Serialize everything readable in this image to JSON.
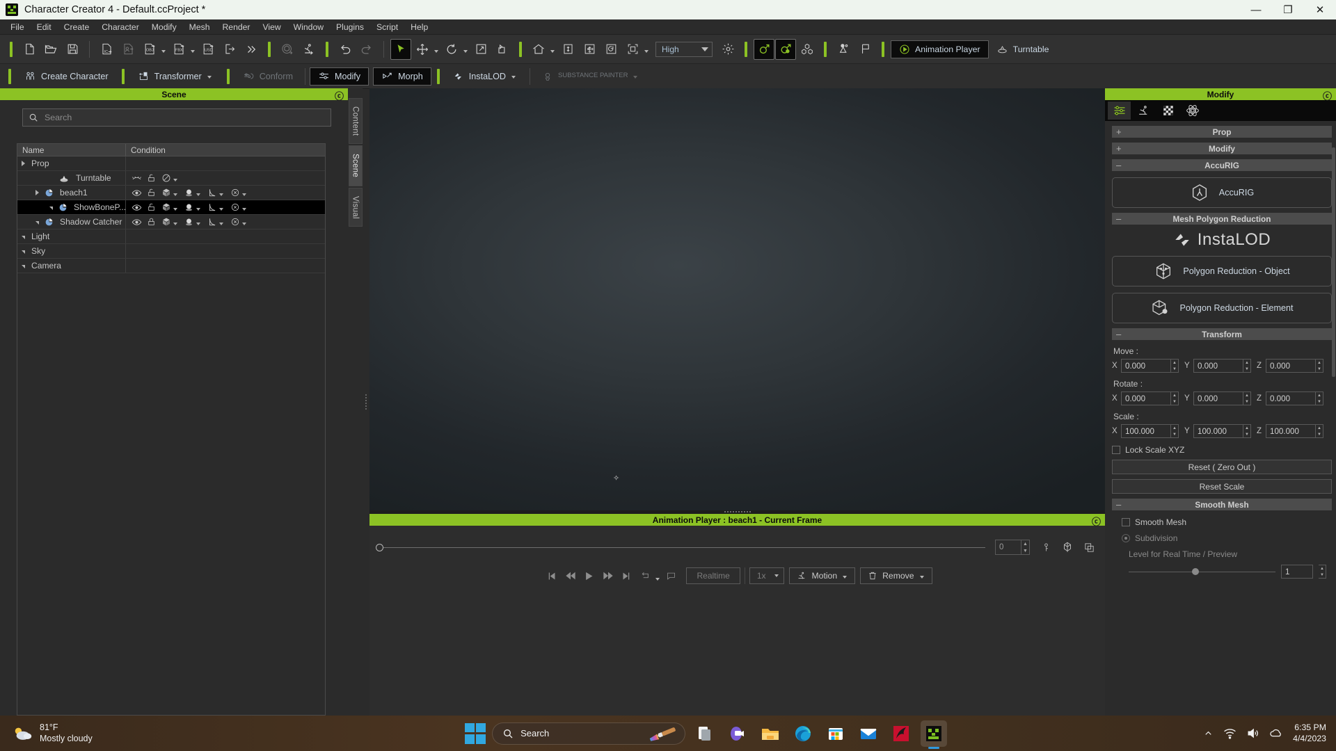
{
  "window": {
    "title": "Character Creator 4 - Default.ccProject *",
    "app_icon": "character-creator-icon",
    "minimize": "—",
    "maximize": "❐",
    "close": "✕"
  },
  "menubar": {
    "items": [
      "File",
      "Edit",
      "Create",
      "Character",
      "Modify",
      "Mesh",
      "Render",
      "View",
      "Window",
      "Plugins",
      "Script",
      "Help"
    ]
  },
  "toolbar_main": {
    "quality_combo": {
      "value": "High"
    },
    "animation_player_label": "Animation Player",
    "turntable_label": "Turntable",
    "icons": [
      "new-file-icon",
      "open-folder-icon",
      "save-icon",
      "import-iclone-icon",
      "import-character-icon",
      "export-obj-icon",
      "export-fbx-icon",
      "export-usd-icon",
      "export-icon",
      "more-chevrons-icon",
      "render-cube-icon",
      "export-motion-icon",
      "undo-icon",
      "redo-icon",
      "select-arrow-icon",
      "move-icon",
      "rotate-icon",
      "scale-icon",
      "pivot-icon",
      "home-view-icon",
      "fit-vertical-icon",
      "fit-all-icon",
      "orbit-icon",
      "frame-selected-icon",
      "light-icon",
      "male-character-icon",
      "female-character-icon",
      "props-icon",
      "stage-icon",
      "flag-icon",
      "play-circle-icon",
      "turntable-icon"
    ]
  },
  "toolbar_modes": {
    "buttons": [
      {
        "label": "Create Character",
        "icon": "create-character-icon",
        "state": "normal",
        "dropdown": false
      },
      {
        "label": "Transformer",
        "icon": "transformer-icon",
        "state": "normal",
        "dropdown": true
      },
      {
        "label": "Conform",
        "icon": "conform-icon",
        "state": "disabled",
        "dropdown": false
      },
      {
        "label": "Modify",
        "icon": "modify-sliders-icon",
        "state": "active",
        "dropdown": false
      },
      {
        "label": "Morph",
        "icon": "morph-icon",
        "state": "active",
        "dropdown": false
      },
      {
        "label": "InstaLOD",
        "icon": "instalod-icon",
        "state": "normal",
        "dropdown": true
      },
      {
        "label": "SUBSTANCE PAINTER",
        "icon": "substance-painter-icon",
        "state": "disabled",
        "dropdown": true
      }
    ]
  },
  "scene_panel": {
    "title": "Scene",
    "close_icon": "close-circle-icon",
    "search": {
      "placeholder": "Search",
      "value": "",
      "icon": "search-icon"
    },
    "columns": [
      "Name",
      "Condition"
    ],
    "rows": [
      {
        "name": "Prop",
        "indent": 0,
        "expander": "down",
        "icon": null,
        "selected": false,
        "conditions": []
      },
      {
        "name": "Turntable",
        "indent": 2,
        "expander": "none",
        "icon": "turntable-obj-icon",
        "selected": false,
        "conditions": [
          "eye-closed-icon",
          "unlock-icon",
          "forbidden-icon"
        ]
      },
      {
        "name": "beach1",
        "indent": 1,
        "expander": "down",
        "icon": "mesh-icon",
        "selected": false,
        "conditions": [
          "eye-icon",
          "unlock-icon",
          "cube-icon",
          "sphere-icon",
          "plane-icon",
          "circle-x-icon"
        ]
      },
      {
        "name": "ShowBoneP...",
        "indent": 2,
        "expander": "right",
        "icon": "mesh-icon",
        "selected": true,
        "conditions": [
          "eye-icon",
          "unlock-icon",
          "cube-icon",
          "sphere-icon",
          "plane-icon",
          "circle-x-icon"
        ]
      },
      {
        "name": "Shadow Catcher",
        "indent": 1,
        "expander": "right",
        "icon": "mesh-icon",
        "selected": false,
        "conditions": [
          "eye-icon",
          "lock-icon",
          "cube-icon",
          "sphere-icon",
          "plane-icon",
          "circle-x-icon"
        ]
      },
      {
        "name": "Light",
        "indent": 0,
        "expander": "right",
        "icon": null,
        "selected": false,
        "conditions": []
      },
      {
        "name": "Sky",
        "indent": 0,
        "expander": "right",
        "icon": null,
        "selected": false,
        "conditions": []
      },
      {
        "name": "Camera",
        "indent": 0,
        "expander": "right",
        "icon": null,
        "selected": false,
        "conditions": []
      }
    ]
  },
  "dock_tabs": [
    {
      "label": "Content",
      "active": false
    },
    {
      "label": "Scene",
      "active": true
    },
    {
      "label": "Visual",
      "active": false
    }
  ],
  "animation_player": {
    "title": "Animation Player : beach1 - Current Frame",
    "close_icon": "close-circle-icon",
    "frame_value": "0",
    "transport": [
      "skip-start-icon",
      "rewind-icon",
      "play-icon",
      "fast-forward-icon",
      "skip-end-icon",
      "loop-icon",
      "comment-icon"
    ],
    "realtime_label": "Realtime",
    "speed_value": "1x",
    "motion_label": "Motion",
    "motion_icon": "motion-icon",
    "remove_label": "Remove",
    "remove_icon": "trash-icon",
    "right_icons": [
      "key-lock-icon",
      "blend-icon",
      "copy-frame-icon"
    ]
  },
  "modify_panel": {
    "title": "Modify",
    "close_icon": "close-circle-icon",
    "tabs": [
      {
        "icon": "sliders-icon",
        "active": true
      },
      {
        "icon": "motion-icon",
        "active": false
      },
      {
        "icon": "checker-icon",
        "active": false
      },
      {
        "icon": "physics-icon",
        "active": false
      }
    ],
    "sections": [
      {
        "label": "Prop",
        "state": "collapsed",
        "toggle": "+"
      },
      {
        "label": "Modify",
        "state": "collapsed",
        "toggle": "+"
      },
      {
        "label": "AccuRIG",
        "state": "expanded",
        "toggle": "–"
      },
      {
        "label": "Mesh Polygon Reduction",
        "state": "expanded",
        "toggle": "–"
      },
      {
        "label": "Transform",
        "state": "expanded",
        "toggle": "–"
      },
      {
        "label": "Smooth Mesh",
        "state": "expanded",
        "toggle": "–"
      }
    ],
    "accurig_button": {
      "label": "AccuRIG",
      "icon": "accurig-icon"
    },
    "instalod_logo": "InstaLOD",
    "polygon_reduction_object": {
      "label": "Polygon Reduction - Object",
      "icon": "cube-reduce-icon"
    },
    "polygon_reduction_element": {
      "label": "Polygon Reduction - Element",
      "icon": "cube-element-icon"
    },
    "transform": {
      "move_label": "Move :",
      "rotate_label": "Rotate :",
      "scale_label": "Scale :",
      "axes": [
        "X",
        "Y",
        "Z"
      ],
      "move": [
        "0.000",
        "0.000",
        "0.000"
      ],
      "rotate": [
        "0.000",
        "0.000",
        "0.000"
      ],
      "scale": [
        "100.000",
        "100.000",
        "100.000"
      ],
      "lock_scale_label": "Lock Scale XYZ",
      "lock_scale_checked": false,
      "reset_zero_label": "Reset ( Zero Out )",
      "reset_scale_label": "Reset Scale"
    },
    "smooth_mesh": {
      "checkbox_label": "Smooth Mesh",
      "checked": false,
      "subdivision_label": "Subdivision",
      "level_label": "Level for Real Time / Preview",
      "level_value": "1"
    }
  },
  "taskbar": {
    "weather": {
      "temperature": "81°F",
      "condition": "Mostly cloudy",
      "icon": "cloud-sun-icon"
    },
    "search": {
      "placeholder": "Search",
      "icon": "search-icon"
    },
    "start_icon": "windows-start-icon",
    "apps": [
      {
        "name": "paint-icon",
        "active": false
      },
      {
        "name": "file-explorer-light-icon",
        "active": false
      },
      {
        "name": "teams-icon",
        "active": false
      },
      {
        "name": "file-explorer-icon",
        "active": false
      },
      {
        "name": "edge-icon",
        "active": false
      },
      {
        "name": "microsoft-store-icon",
        "active": false
      },
      {
        "name": "mail-icon",
        "active": false
      },
      {
        "name": "firefox-dev-icon",
        "active": false
      },
      {
        "name": "character-creator-icon",
        "active": true
      }
    ],
    "tray": {
      "chevron_icon": "chevron-up-icon",
      "wifi_icon": "wifi-icon",
      "volume_icon": "volume-icon",
      "onedrive_icon": "onedrive-icon"
    },
    "clock": {
      "time": "6:35 PM",
      "date": "4/4/2023"
    }
  },
  "colors": {
    "accent_green": "#8cc224",
    "panel_bg": "#2b2b2b",
    "toolbar_bg": "#313131",
    "titlebar_bg": "#eef4ee"
  }
}
